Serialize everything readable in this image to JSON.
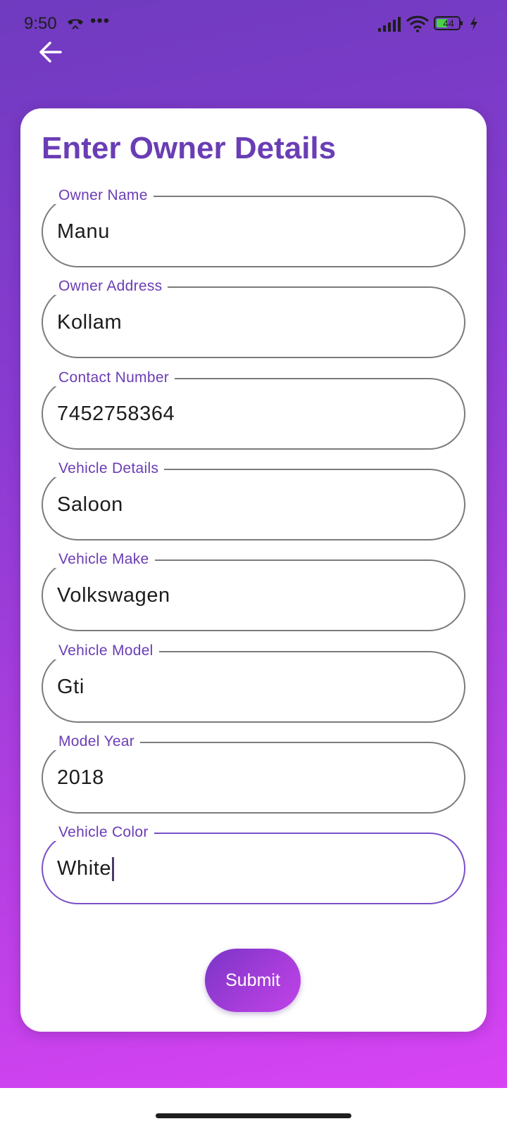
{
  "status_bar": {
    "time": "9:50",
    "more": "•••",
    "battery_level": "44",
    "icons": [
      "call-icon",
      "signal-icon",
      "wifi-icon",
      "battery-icon",
      "charging-bolt-icon"
    ]
  },
  "header": {
    "back_icon": "arrow-back-icon"
  },
  "form": {
    "title": "Enter Owner Details",
    "fields": [
      {
        "label": "Owner Name",
        "value": "Manu"
      },
      {
        "label": "Owner Address",
        "value": "Kollam"
      },
      {
        "label": "Contact Number",
        "value": "7452758364"
      },
      {
        "label": "Vehicle Details",
        "value": "Saloon"
      },
      {
        "label": "Vehicle Make",
        "value": "Volkswagen"
      },
      {
        "label": "Vehicle Model",
        "value": "Gti"
      },
      {
        "label": "Model Year",
        "value": "2018"
      },
      {
        "label": "Vehicle Color",
        "value": "White"
      }
    ],
    "submit_label": "Submit"
  },
  "colors": {
    "accent": "#6a3db5",
    "gradient_top": "#6f3bbf",
    "gradient_bottom": "#dc44f6",
    "field_border": "#7b7b7b",
    "focused_border": "#7b4fc8"
  }
}
